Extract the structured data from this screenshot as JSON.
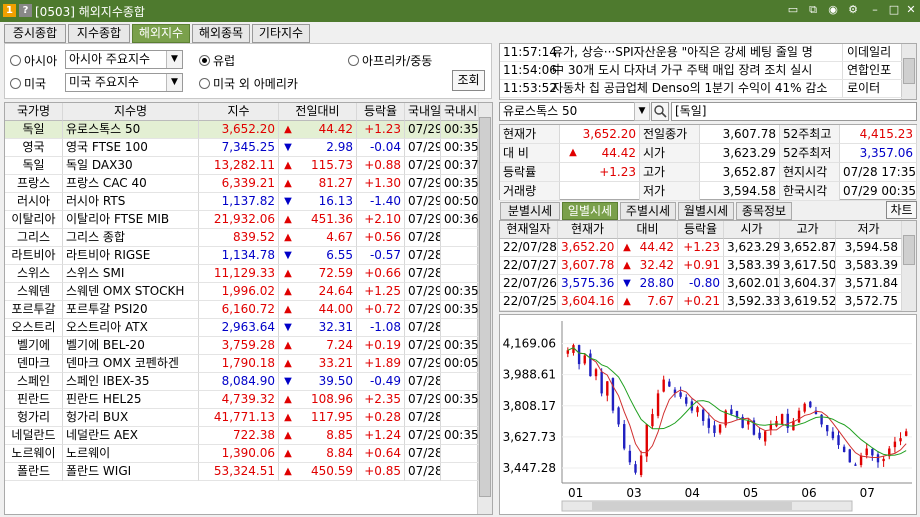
{
  "window": {
    "title": "[0503] 해외지수종합",
    "badges": [
      "1",
      "?"
    ]
  },
  "tabs": [
    {
      "label": "증시종합",
      "w": 62
    },
    {
      "label": "지수종합",
      "w": 62
    },
    {
      "label": "해외지수",
      "w": 58,
      "active": true
    },
    {
      "label": "해외종목",
      "w": 58
    },
    {
      "label": "기타지수",
      "w": 58
    }
  ],
  "filters": {
    "asia": {
      "label": "아시아",
      "select": "아시아 주요지수"
    },
    "europe": {
      "label": "유럽"
    },
    "africa": {
      "label": "아프리카/중동"
    },
    "us": {
      "label": "미국",
      "select": "미국 주요지수"
    },
    "america": {
      "label": "미국 외 아메리카"
    },
    "search_btn": "조회"
  },
  "index_table": {
    "headers": [
      "국가명",
      "지수명",
      "지수",
      "전일대비",
      "등락율",
      "국내일",
      "국내시각"
    ],
    "rows": [
      [
        "독일",
        "유로스톡스 50",
        "3,652.20",
        "up",
        "44.42",
        "+1.23",
        "07/29",
        "00:35:45"
      ],
      [
        "영국",
        "영국 FTSE 100",
        "7,345.25",
        "dn",
        "2.98",
        "-0.04",
        "07/29",
        "00:35:30"
      ],
      [
        "독일",
        "독일 DAX30",
        "13,282.11",
        "up",
        "115.73",
        "+0.88",
        "07/29",
        "00:37:46"
      ],
      [
        "프랑스",
        "프랑스 CAC 40",
        "6,339.21",
        "up",
        "81.27",
        "+1.30",
        "07/29",
        "00:35:30"
      ],
      [
        "러시아",
        "러시아 RTS",
        "1,137.82",
        "dn",
        "16.13",
        "-1.40",
        "07/29",
        "00:50:00"
      ],
      [
        "이탈리아",
        "이탈리아 FTSE MIB",
        "21,932.06",
        "up",
        "451.36",
        "+2.10",
        "07/29",
        "00:36:00"
      ],
      [
        "그리스",
        "그리스 종합",
        "839.52",
        "up",
        "4.67",
        "+0.56",
        "07/28",
        ""
      ],
      [
        "라트비아",
        "라트비아 RIGSE",
        "1,134.78",
        "dn",
        "6.55",
        "-0.57",
        "07/28",
        ""
      ],
      [
        "스위스",
        "스위스 SMI",
        "11,129.33",
        "up",
        "72.59",
        "+0.66",
        "07/28",
        ""
      ],
      [
        "스웨덴",
        "스웨덴 OMX STOCKH",
        "1,996.02",
        "up",
        "24.64",
        "+1.25",
        "07/29",
        "00:35:00"
      ],
      [
        "포르투갈",
        "포르투갈 PSI20",
        "6,160.72",
        "up",
        "44.00",
        "+0.72",
        "07/29",
        "00:35:30"
      ],
      [
        "오스트리",
        "오스트리아 ATX",
        "2,963.64",
        "dn",
        "32.31",
        "-1.08",
        "07/28",
        ""
      ],
      [
        "벨기에",
        "벨기에 BEL-20",
        "3,759.28",
        "up",
        "7.24",
        "+0.19",
        "07/29",
        "00:35:30"
      ],
      [
        "덴마크",
        "덴마크 OMX 코펜하겐",
        "1,790.18",
        "up",
        "33.21",
        "+1.89",
        "07/29",
        "00:05:00"
      ],
      [
        "스페인",
        "스페인 IBEX-35",
        "8,084.90",
        "dn",
        "39.50",
        "-0.49",
        "07/28",
        ""
      ],
      [
        "핀란드",
        "핀란드 HEL25",
        "4,739.32",
        "up",
        "108.96",
        "+2.35",
        "07/29",
        "00:35:07"
      ],
      [
        "헝가리",
        "헝가리 BUX",
        "41,771.13",
        "up",
        "117.95",
        "+0.28",
        "07/28",
        ""
      ],
      [
        "네덜란드",
        "네덜란드 AEX",
        "722.38",
        "up",
        "8.85",
        "+1.24",
        "07/29",
        "00:35:30"
      ],
      [
        "노르웨이",
        "노르웨이",
        "1,390.06",
        "up",
        "8.84",
        "+0.64",
        "07/28",
        ""
      ],
      [
        "폴란드",
        "폴란드 WIGI",
        "53,324.51",
        "up",
        "450.59",
        "+0.85",
        "07/28",
        ""
      ]
    ]
  },
  "news": [
    {
      "time": "11:57:14",
      "text": "유가, 상승···SPI자산운용 \"아직은 강세 베팅 줄일 명",
      "src": "이데일리"
    },
    {
      "time": "11:54:06",
      "text": "中 30개 도시 다자녀 가구 주택 매입 장려 조치 실시",
      "src": "연합인포"
    },
    {
      "time": "11:53:52",
      "text": "자동차 칩 공급업체 Denso의 1분기 수익이 41% 감소",
      "src": "로이터"
    }
  ],
  "quote_bar": {
    "name": "유로스톡스 50",
    "market": "[독일]"
  },
  "quote": {
    "current_label": "현재가",
    "current": "3,652.20",
    "prev_label": "전일종가",
    "prev": "3,607.78",
    "hi52_label": "52주최고",
    "hi52": "4,415.23",
    "diff_label": "대 비",
    "diff": "44.42",
    "open_label": "시가",
    "open": "3,623.29",
    "lo52_label": "52주최저",
    "lo52": "3,357.06",
    "rate_label": "등락률",
    "rate": "+1.23",
    "high_label": "고가",
    "high": "3,652.87",
    "local_label": "현지시각",
    "local": "07/28 17:35",
    "vol_label": "거래량",
    "vol": "",
    "low_label": "저가",
    "low": "3,594.58",
    "kr_label": "한국시각",
    "kr": "07/29 00:35"
  },
  "period_tabs": [
    {
      "label": "분별시세",
      "w": 60
    },
    {
      "label": "일별시세",
      "w": 56,
      "active": true
    },
    {
      "label": "주별시세",
      "w": 56
    },
    {
      "label": "월별시세",
      "w": 56
    },
    {
      "label": "종목정보",
      "w": 56
    }
  ],
  "chart_btn": "차트",
  "price_table": {
    "headers": [
      "현재일자",
      "현재가",
      "대비",
      "등락율",
      "시가",
      "고가",
      "저가"
    ],
    "rows": [
      [
        "22/07/28",
        "3,652.20",
        "up",
        "44.42",
        "+1.23",
        "3,623.29",
        "3,652.87",
        "3,594.58"
      ],
      [
        "22/07/27",
        "3,607.78",
        "up",
        "32.42",
        "+0.91",
        "3,583.39",
        "3,617.50",
        "3,583.39"
      ],
      [
        "22/07/26",
        "3,575.36",
        "dn",
        "28.80",
        "-0.80",
        "3,602.01",
        "3,604.37",
        "3,571.84"
      ],
      [
        "22/07/25",
        "3,604.16",
        "up",
        "7.67",
        "+0.21",
        "3,592.33",
        "3,619.52",
        "3,572.75"
      ]
    ]
  },
  "chart_data": {
    "type": "candlestick",
    "y_ticks": [
      "4,169.06",
      "3,988.61",
      "3,808.17",
      "3,627.73",
      "3,447.28"
    ],
    "y_tick_values": [
      4169.06,
      3988.61,
      3808.17,
      3627.73,
      3447.28
    ],
    "x_ticks": [
      "01",
      "03",
      "04",
      "05",
      "06",
      "07"
    ],
    "ylim": [
      3360,
      4300
    ],
    "close_path": [
      4130,
      4160,
      4050,
      4100,
      3980,
      4020,
      3880,
      3950,
      3780,
      3700,
      3560,
      3480,
      3420,
      3520,
      3700,
      3760,
      3880,
      3960,
      3920,
      3880,
      3860,
      3820,
      3780,
      3800,
      3720,
      3680,
      3650,
      3700,
      3780,
      3760,
      3740,
      3680,
      3720,
      3640,
      3620,
      3660,
      3700,
      3720,
      3760,
      3680,
      3720,
      3780,
      3820,
      3800,
      3760,
      3700,
      3660,
      3620,
      3580,
      3540,
      3480,
      3460,
      3520,
      3560,
      3520,
      3480,
      3500,
      3560,
      3600,
      3620,
      3660
    ]
  },
  "icons": [
    "window-icon",
    "restore-icon",
    "camera-icon",
    "copy-icon",
    "settings-icon",
    "minimize-icon",
    "close-icon"
  ]
}
